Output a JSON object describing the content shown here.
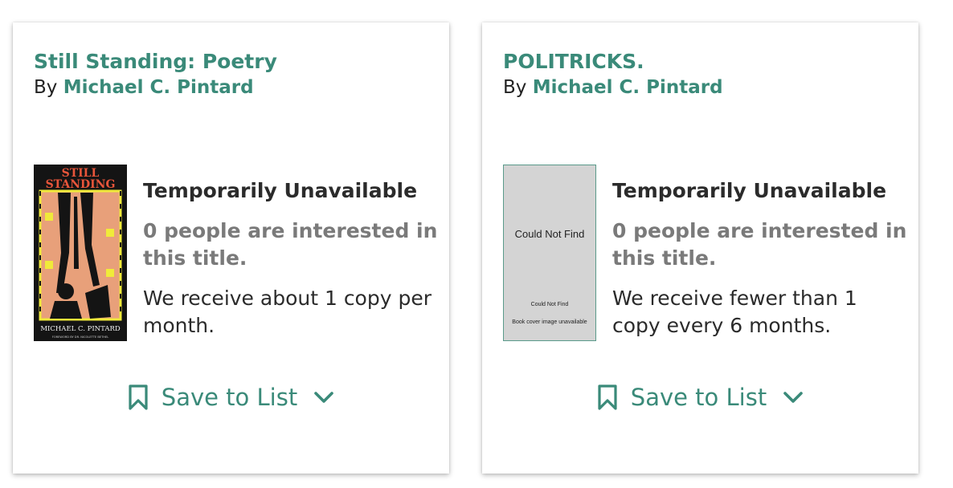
{
  "cards": [
    {
      "title": "Still Standing: Poetry",
      "by_label": "By",
      "author": "Michael C. Pintard",
      "cover": {
        "title_line1": "STILL",
        "title_line2": "STANDING",
        "author": "MICHAEL C. PINTARD",
        "foreword": "FOREWORD BY DR. NICOLETTE BETHEL"
      },
      "status": "Temporarily Unavailable",
      "interest": "0 people are interested in this title.",
      "receive": "We receive about 1 copy per month.",
      "save_label": "Save to List"
    },
    {
      "title": "POLITRICKS.",
      "by_label": "By",
      "author": "Michael C. Pintard",
      "cover": {
        "missing_main": "Could Not Find",
        "missing_small": "Could Not Find",
        "missing_caption": "Book cover image unavailable"
      },
      "status": "Temporarily Unavailable",
      "interest": "0 people are interested in this title.",
      "receive": "We receive fewer than 1 copy every 6 months.",
      "save_label": "Save to List"
    }
  ],
  "colors": {
    "accent": "#3a8a79",
    "text": "#2b2b2b",
    "muted": "#7a7a7a"
  }
}
